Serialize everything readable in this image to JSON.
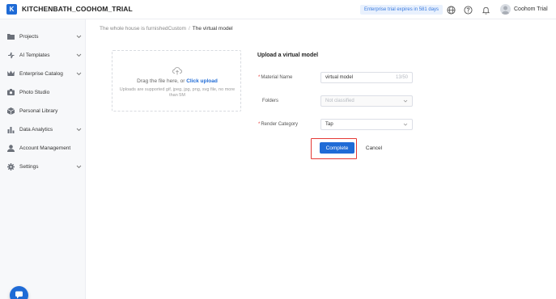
{
  "header": {
    "logo_letter": "K",
    "app_title": "KITCHENBATH_COOHOM_TRIAL",
    "trial_badge": "Enterprise trial expires in 581 days",
    "user_name": "Coohom Trial",
    "icons": [
      "globe-icon",
      "help-icon",
      "bell-icon"
    ]
  },
  "sidebar": {
    "items": [
      {
        "label": "Projects",
        "icon": "folder-icon",
        "has_chevron": true
      },
      {
        "label": "AI Templates",
        "icon": "sparkle-icon",
        "has_chevron": true
      },
      {
        "label": "Enterprise Catalog",
        "icon": "crown-icon",
        "has_chevron": true
      },
      {
        "label": "Photo Studio",
        "icon": "camera-icon",
        "has_chevron": false
      },
      {
        "label": "Personal Library",
        "icon": "cube-icon",
        "has_chevron": false
      },
      {
        "label": "Data Analytics",
        "icon": "chart-icon",
        "has_chevron": true
      },
      {
        "label": "Account Management",
        "icon": "user-icon",
        "has_chevron": false
      },
      {
        "label": "Settings",
        "icon": "gear-icon",
        "has_chevron": true
      }
    ]
  },
  "breadcrumb": {
    "parent": "The whole house is furnishedCustom",
    "separator": "/",
    "current": "The virtual model"
  },
  "upload": {
    "prompt": "Drag the file here, or",
    "link": "Click upload",
    "hint": "Uploads are supported gif, jpeg, jpg, png, svg file, no more than 5M"
  },
  "form": {
    "title": "Upload a virtual model",
    "material_name": {
      "label": "Material Name",
      "required": true,
      "value": "virtual model",
      "count": "13/50"
    },
    "folders": {
      "label": "Folders",
      "required": false,
      "placeholder": "Not classified"
    },
    "render_category": {
      "label": "Render Category",
      "required": true,
      "value": "Tap"
    },
    "complete_label": "Complete",
    "cancel_label": "Cancel"
  },
  "colors": {
    "accent": "#1f6bd6",
    "highlight": "#e53935",
    "sidebar_bg": "#f7f8fa"
  }
}
